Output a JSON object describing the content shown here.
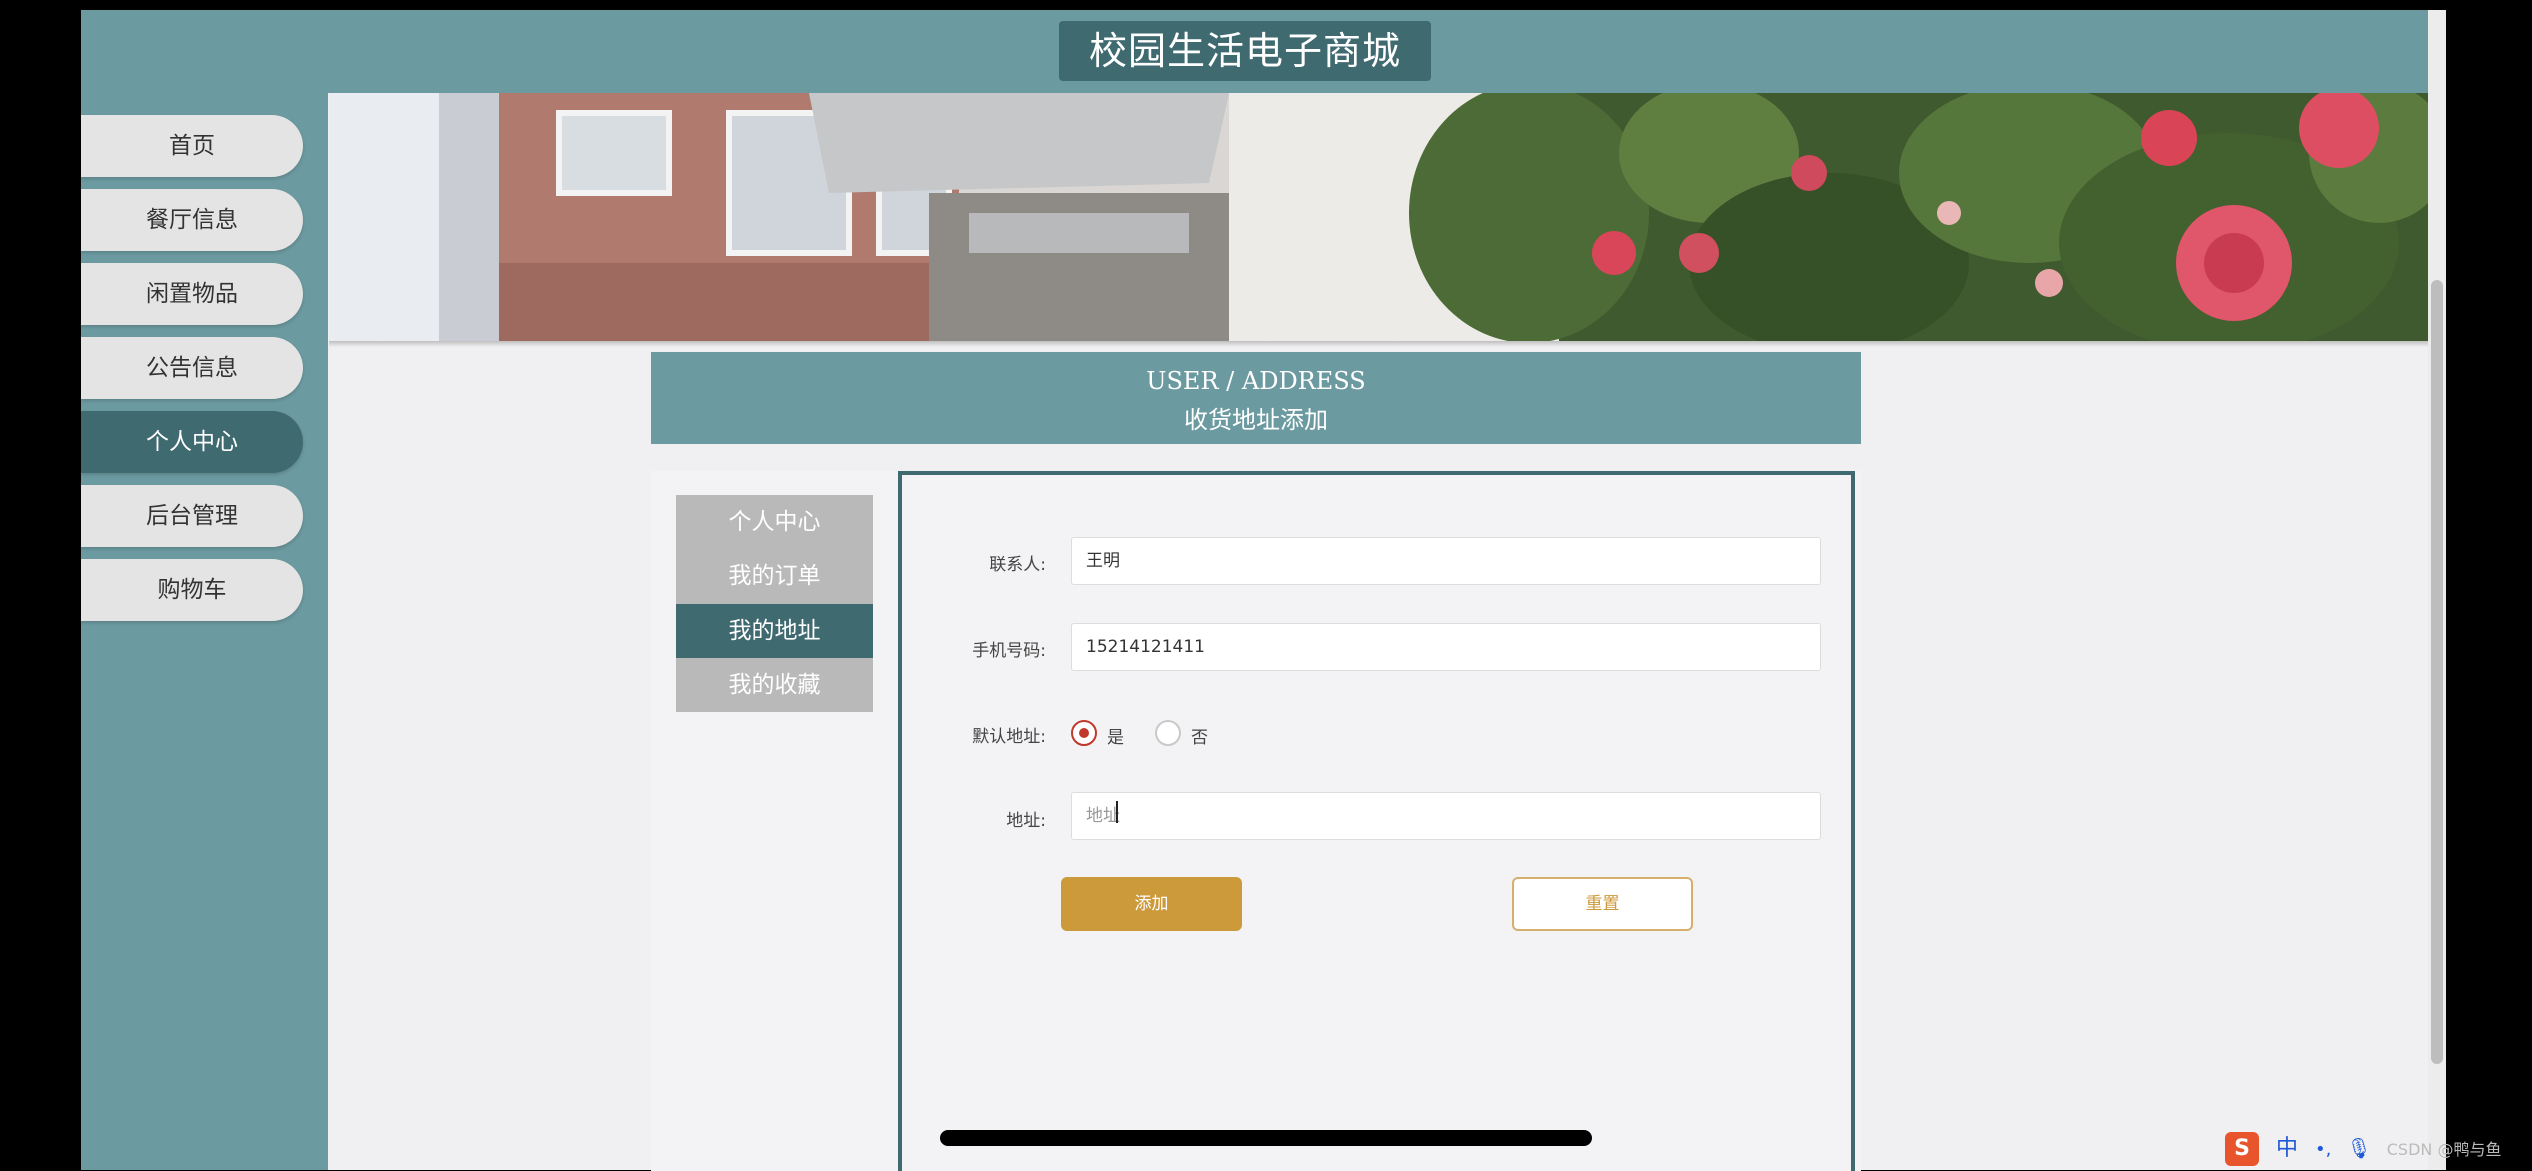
{
  "header": {
    "title": "校园生活电子商城"
  },
  "sidebar": {
    "items": [
      {
        "label": "首页",
        "active": false
      },
      {
        "label": "餐厅信息",
        "active": false
      },
      {
        "label": "闲置物品",
        "active": false
      },
      {
        "label": "公告信息",
        "active": false
      },
      {
        "label": "个人中心",
        "active": true
      },
      {
        "label": "后台管理",
        "active": false
      },
      {
        "label": "购物车",
        "active": false
      }
    ]
  },
  "section": {
    "title_en": "USER / ADDRESS",
    "title_cn": "收货地址添加"
  },
  "sub_nav": {
    "items": [
      {
        "label": "个人中心",
        "active": false
      },
      {
        "label": "我的订单",
        "active": false
      },
      {
        "label": "我的地址",
        "active": true
      },
      {
        "label": "我的收藏",
        "active": false
      }
    ]
  },
  "form": {
    "contact_label": "联系人:",
    "contact_value": "王明",
    "phone_label": "手机号码:",
    "phone_value": "15214121411",
    "default_label": "默认地址:",
    "default_yes": "是",
    "default_no": "否",
    "default_selected": "是",
    "address_label": "地址:",
    "address_placeholder": "地址",
    "submit_label": "添加",
    "reset_label": "重置"
  },
  "ime": {
    "logo": "S",
    "mode": "中",
    "watermark": "CSDN @鸭与鱼"
  },
  "colors": {
    "teal": "#6b9aa0",
    "dark_teal": "#3f6a70",
    "gold": "#cc9a3b",
    "radio_red": "#c0392b"
  }
}
